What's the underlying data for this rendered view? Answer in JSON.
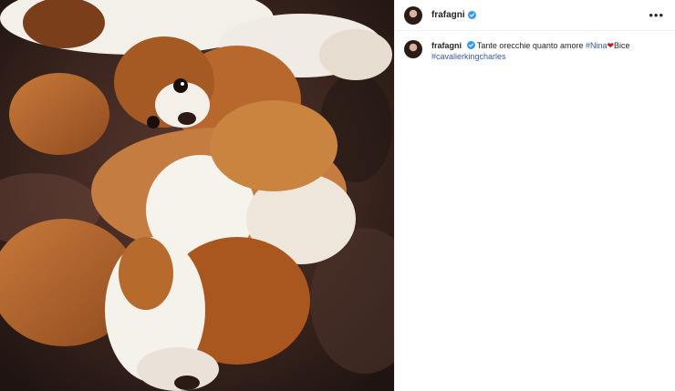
{
  "post": {
    "author": {
      "username": "frafagni",
      "verified": true,
      "verified_icon": "verified-badge-icon"
    },
    "more_icon": "more-options-icon",
    "more_label": "•••",
    "caption": {
      "text_start": "Tante orecchie quanto amore",
      "tag_1": "#Nina",
      "heart": "❤",
      "text_after_heart": "Bice",
      "tag_2": "#cavalierkingcharles"
    },
    "photo": {
      "subject": "two cavalier king charles dogs on a leather sofa"
    }
  },
  "colors": {
    "verified_blue": "#3897f0",
    "hashtag": "#385898",
    "heart": "#c0172b",
    "border": "#efefef"
  }
}
